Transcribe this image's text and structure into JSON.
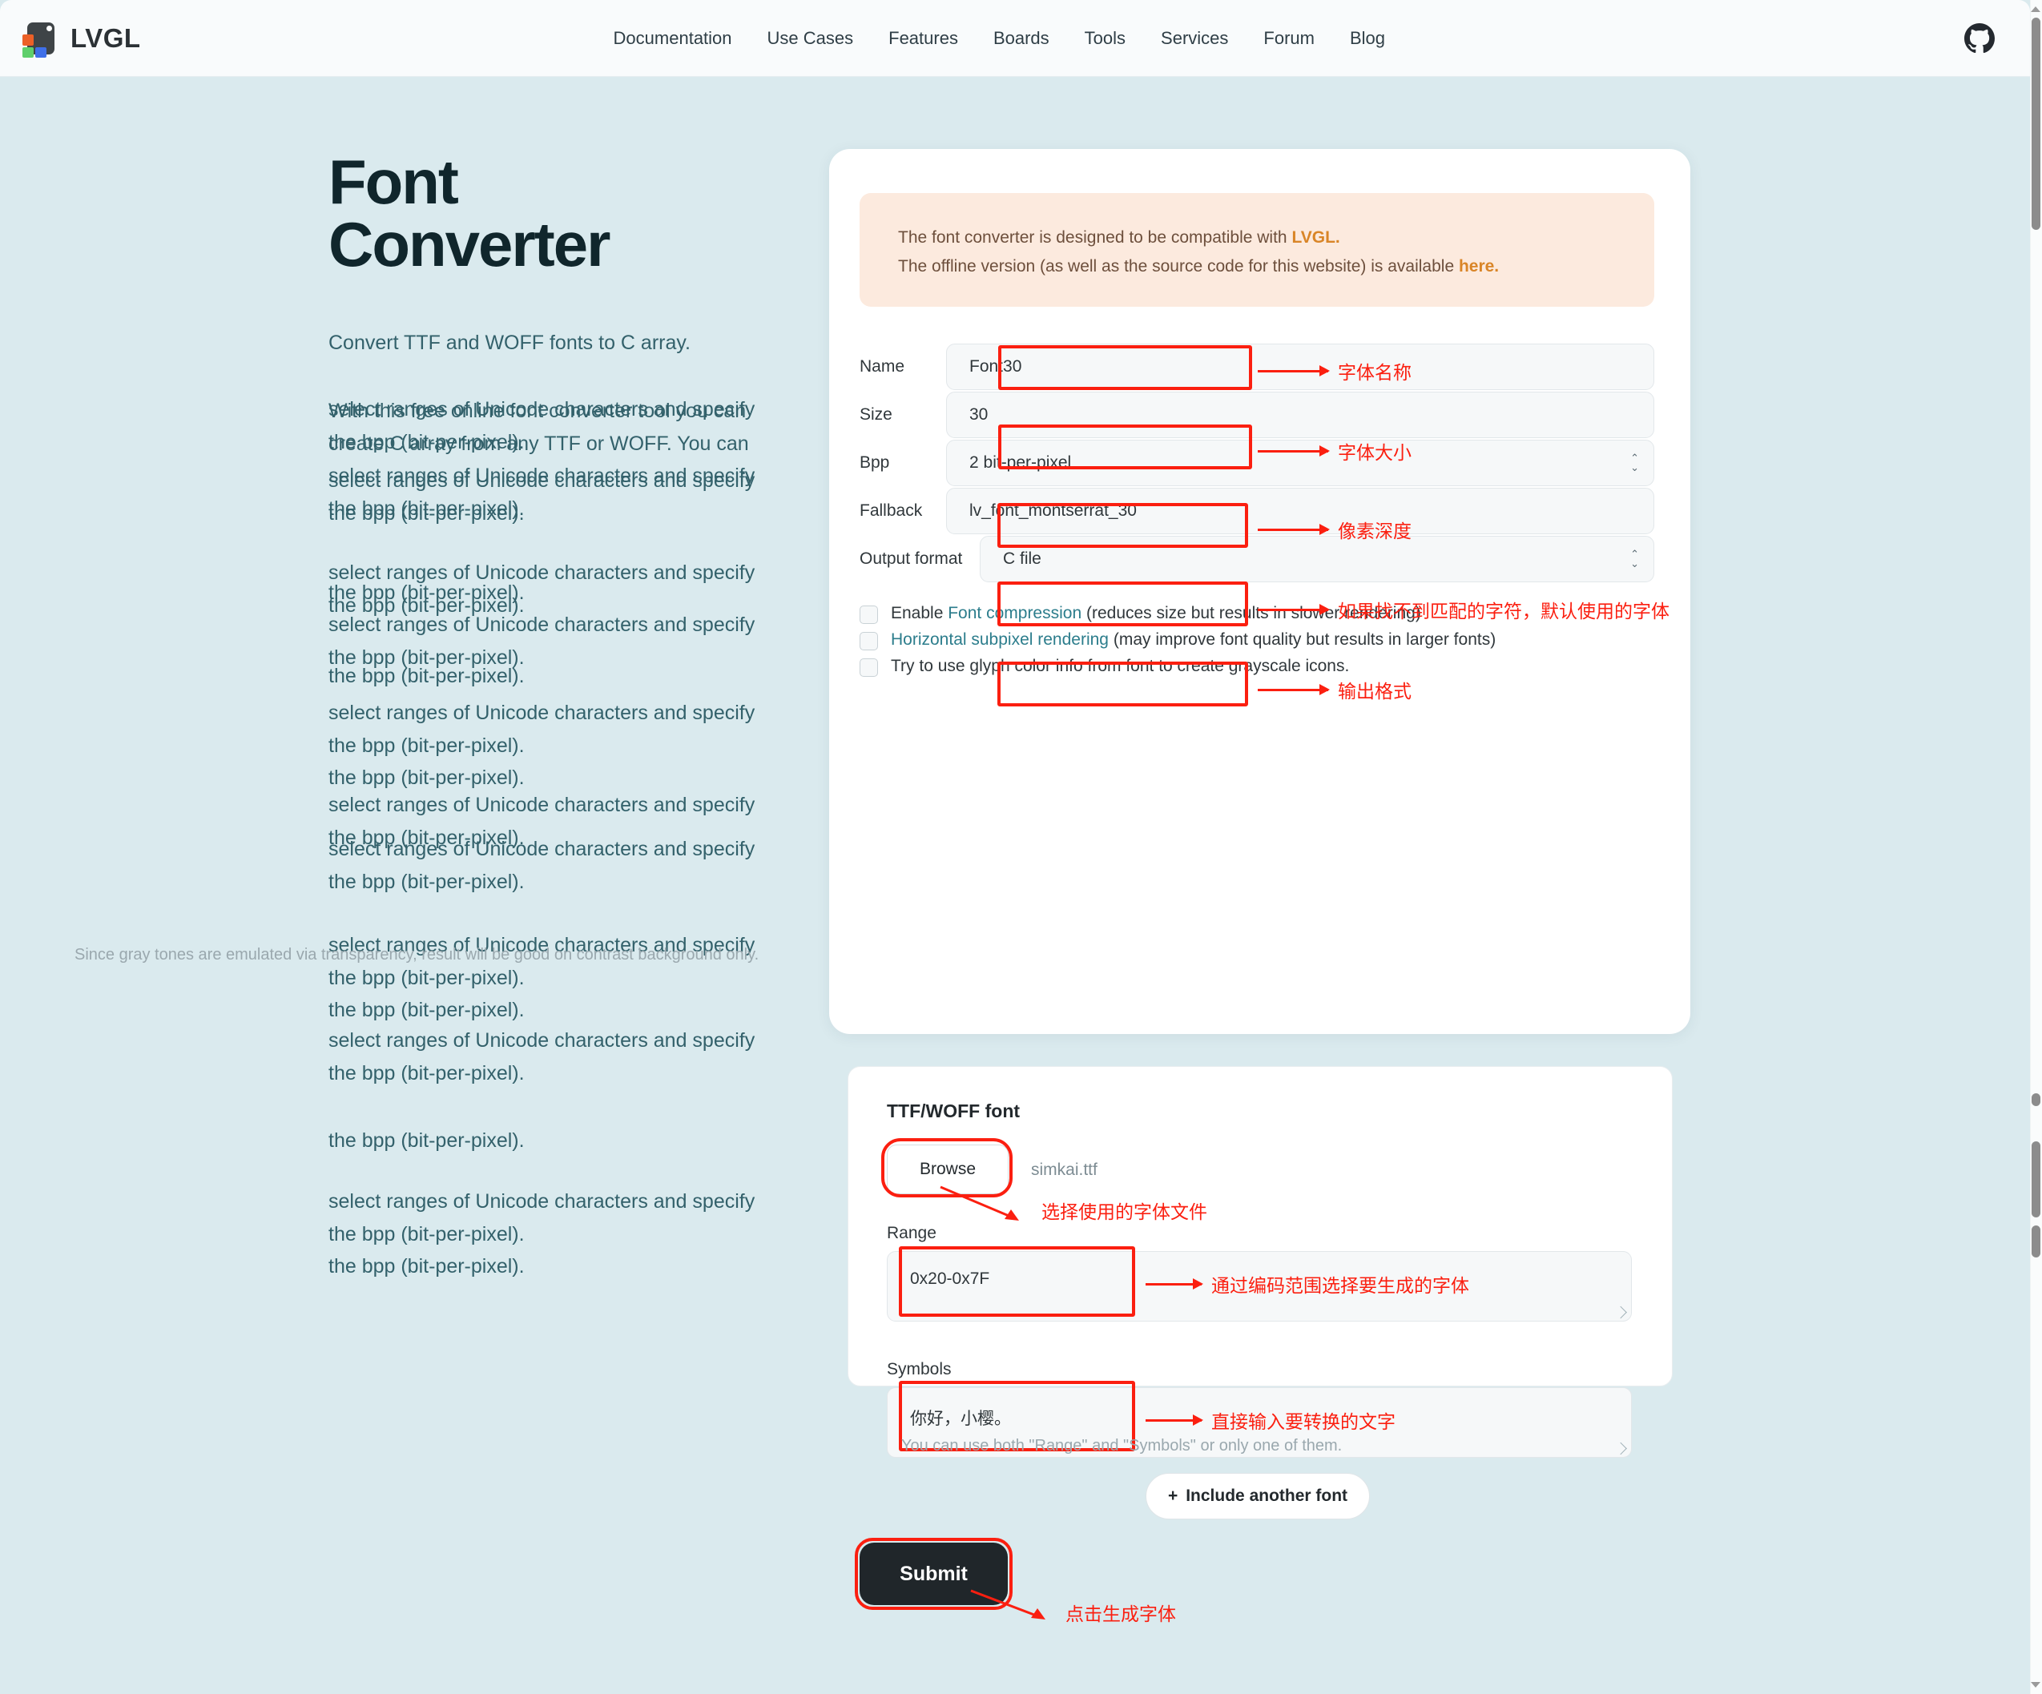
{
  "nav": {
    "brand": "LVGL",
    "links": [
      "Documentation",
      "Use Cases",
      "Features",
      "Boards",
      "Tools",
      "Services",
      "Forum",
      "Blog"
    ],
    "github_icon": "github-icon"
  },
  "hero": {
    "title_line1": "Font",
    "title_line2": "Converter",
    "subtitle": "Convert TTF and WOFF fonts to C array.",
    "intro": "With this free online font converter tool you can create C array from any TTF or WOFF. You can select ranges of Unicode characters and specify the bpp (bit-per-pixel).",
    "ghost_fragment_a": "select ranges of Unicode characters and specify",
    "ghost_fragment_b": "the bpp (bit-per-pixel)."
  },
  "notice": {
    "line1_pre": "The font converter is designed to be compatible with ",
    "line1_link": "LVGL.",
    "line2_pre": "The offline version (as well as the source code for this website) is available ",
    "line2_link": "here."
  },
  "form": {
    "name_label": "Name",
    "name_value": "Font30",
    "name_anno": "字体名称",
    "size_label": "Size",
    "size_value": "30",
    "size_anno": "字体大小",
    "bpp_label": "Bpp",
    "bpp_value": "2 bit-per-pixel",
    "bpp_anno": "像素深度",
    "fallback_label": "Fallback",
    "fallback_value": "lv_font_montserrat_30",
    "fallback_anno": "如果找不到匹配的字符，默认使用的字体",
    "output_label": "Output format",
    "output_value": "C file",
    "output_anno": "输出格式"
  },
  "checkboxes": {
    "compression_pre": "Enable ",
    "compression_link": "Font compression",
    "compression_post": " (reduces size but results in slower rendering)",
    "subpixel_link": "Horizontal subpixel rendering",
    "subpixel_post": " (may improve font quality but results in larger fonts)",
    "glyph_color": "Try to use glyph color info from font to create grayscale icons.",
    "glyph_color_help": "Since gray tones are emulated via transparency, result will be good on contrast background only."
  },
  "font_panel": {
    "title": "TTF/WOFF font",
    "browse_label": "Browse",
    "file_name": "simkai.ttf",
    "browse_anno": "选择使用的字体文件",
    "range_label": "Range",
    "range_value": "0x20-0x7F",
    "range_anno": "通过编码范围选择要生成的字体",
    "symbols_label": "Symbols",
    "symbols_value": "你好，小樱。",
    "symbols_anno": "直接输入要转换的文字",
    "range_help": "You can use both \"Range\" and \"Symbols\" or only one of them.",
    "include_label": "Include another font",
    "include_plus": "+"
  },
  "actions": {
    "submit_label": "Submit",
    "submit_anno": "点击生成字体"
  },
  "colors": {
    "page_bg": "#daeaee",
    "nav_bg": "#f9fbfc",
    "card_bg": "#ffffff",
    "notice_bg": "#fceade",
    "notice_link": "#d98527",
    "teal_text": "#33616b",
    "anno_red": "#fb1f10",
    "submit_bg": "#20262a",
    "link_teal": "#2c7d8c"
  }
}
